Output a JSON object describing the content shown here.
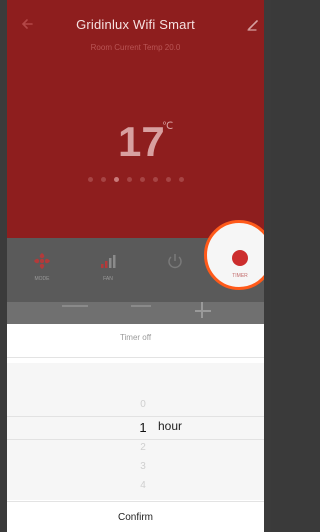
{
  "header": {
    "title": "Gridinlux  Wifi Smart",
    "room_temp": "Room   Current Temp 20.0",
    "setpoint": "17",
    "unit": "℃"
  },
  "controls": {
    "mode": {
      "label": "MODE",
      "icon": "fan-icon"
    },
    "fan": {
      "label": "FAN",
      "icon": "signal-bars-icon"
    },
    "power": {
      "label": "",
      "icon": "power-icon"
    },
    "timer": {
      "label": "TIMER",
      "icon": "clock-icon"
    }
  },
  "timer_sheet": {
    "title": "Timer off",
    "options": [
      "0",
      "1",
      "2",
      "3",
      "4"
    ],
    "selected": "1",
    "unit": "hour",
    "confirm_label": "Confirm"
  },
  "colors": {
    "header_bg": "#8e1e1e",
    "highlight": "#ff5a1a",
    "timer_icon": "#cc2d2d"
  }
}
